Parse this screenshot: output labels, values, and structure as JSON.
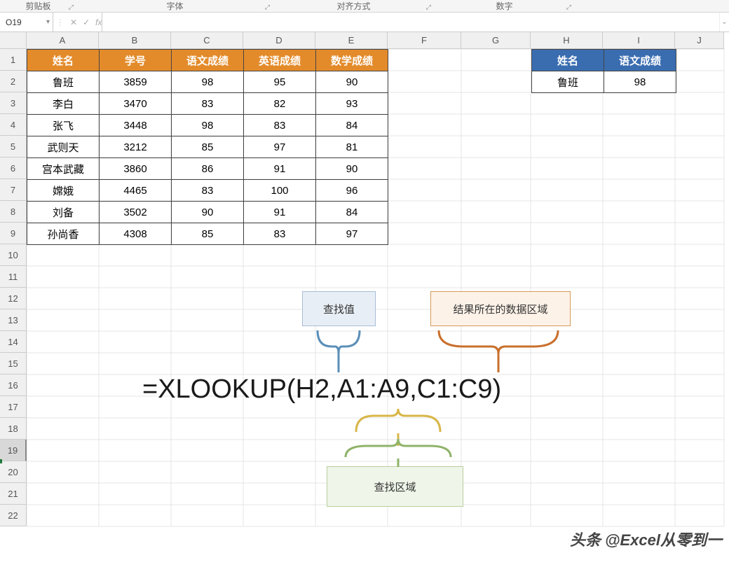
{
  "ribbon": {
    "groups": [
      "剪贴板",
      "字体",
      "对齐方式",
      "数字"
    ],
    "launcher_glyph": "▸"
  },
  "name_box": "O19",
  "formula_bar": {
    "cancel": "✕",
    "confirm": "✓",
    "fx": "fx",
    "value": ""
  },
  "columns": [
    "A",
    "B",
    "C",
    "D",
    "E",
    "F",
    "G",
    "H",
    "I",
    "J"
  ],
  "row_count": 22,
  "selected_row": 19,
  "main_table": {
    "headers": [
      "姓名",
      "学号",
      "语文成绩",
      "英语成绩",
      "数学成绩"
    ],
    "header_colors": [
      "th-orange",
      "th-orange",
      "th-orange",
      "th-orange",
      "th-orange"
    ],
    "rows": [
      [
        "鲁班",
        "3859",
        "98",
        "95",
        "90"
      ],
      [
        "李白",
        "3470",
        "83",
        "82",
        "93"
      ],
      [
        "张飞",
        "3448",
        "98",
        "83",
        "84"
      ],
      [
        "武则天",
        "3212",
        "85",
        "97",
        "81"
      ],
      [
        "宫本武藏",
        "3860",
        "86",
        "91",
        "90"
      ],
      [
        "嫦娥",
        "4465",
        "83",
        "100",
        "96"
      ],
      [
        "刘备",
        "3502",
        "90",
        "91",
        "84"
      ],
      [
        "孙尚香",
        "4308",
        "85",
        "83",
        "97"
      ]
    ]
  },
  "lookup_table": {
    "headers": [
      "姓名",
      "语文成绩"
    ],
    "rows": [
      [
        "鲁班",
        "98"
      ]
    ]
  },
  "annotations": {
    "lookup_value": "查找值",
    "result_range": "结果所在的数据区域",
    "lookup_range": "查找区域"
  },
  "formula_display": "=XLOOKUP(H2,A1:A9,C1:C9)",
  "watermark": "头条 @Excel从零到一",
  "colors": {
    "orange": "#e38b2a",
    "blue": "#3a6db0",
    "brace_blue": "#5b8fb8",
    "brace_orange": "#c96f2c",
    "brace_yellow": "#d8b648",
    "brace_green": "#8fb36a"
  }
}
